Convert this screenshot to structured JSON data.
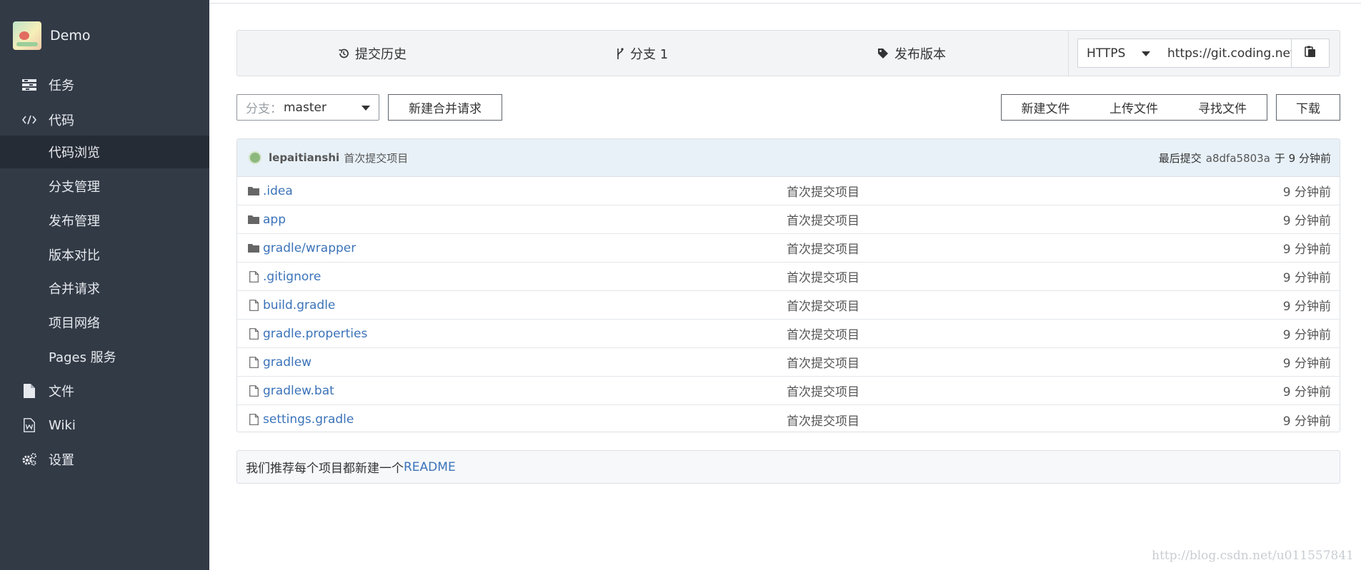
{
  "app": {
    "project_name": "Demo"
  },
  "sidebar": {
    "items": [
      {
        "label": "任务",
        "icon": "tasks-icon"
      },
      {
        "label": "代码",
        "icon": "code-icon"
      },
      {
        "label": "代码浏览",
        "sub": true,
        "active": true
      },
      {
        "label": "分支管理",
        "sub": true
      },
      {
        "label": "发布管理",
        "sub": true
      },
      {
        "label": "版本对比",
        "sub": true
      },
      {
        "label": "合并请求",
        "sub": true
      },
      {
        "label": "项目网络",
        "sub": true
      },
      {
        "label": "Pages 服务",
        "sub": true
      },
      {
        "label": "文件",
        "icon": "file-icon"
      },
      {
        "label": "Wiki",
        "icon": "wiki-icon"
      },
      {
        "label": "设置",
        "icon": "gears-icon"
      }
    ]
  },
  "repo_bar": {
    "history_label": "提交历史",
    "branches_label": "分支 1",
    "releases_label": "发布版本",
    "protocol": "HTTPS",
    "clone_url": "https://git.coding.net/le"
  },
  "toolbar": {
    "branch_prefix": "分支：",
    "branch_value": "master",
    "new_merge_request": "新建合并请求",
    "new_file": "新建文件",
    "upload_file": "上传文件",
    "find_file": "寻找文件",
    "download": "下载"
  },
  "last_commit": {
    "author": "lepaitianshi",
    "message": "首次提交项目",
    "prefix": "最后提交",
    "hash": "a8dfa5803a",
    "time": "于 9 分钟前"
  },
  "files": [
    {
      "name": ".idea",
      "type": "folder",
      "commit": "首次提交项目",
      "time": "9 分钟前"
    },
    {
      "name": "app",
      "type": "folder",
      "commit": "首次提交项目",
      "time": "9 分钟前"
    },
    {
      "name": "gradle/wrapper",
      "type": "folder",
      "commit": "首次提交项目",
      "time": "9 分钟前"
    },
    {
      "name": ".gitignore",
      "type": "file",
      "commit": "首次提交项目",
      "time": "9 分钟前"
    },
    {
      "name": "build.gradle",
      "type": "file",
      "commit": "首次提交项目",
      "time": "9 分钟前"
    },
    {
      "name": "gradle.properties",
      "type": "file",
      "commit": "首次提交项目",
      "time": "9 分钟前"
    },
    {
      "name": "gradlew",
      "type": "file",
      "commit": "首次提交项目",
      "time": "9 分钟前"
    },
    {
      "name": "gradlew.bat",
      "type": "file",
      "commit": "首次提交项目",
      "time": "9 分钟前"
    },
    {
      "name": "settings.gradle",
      "type": "file",
      "commit": "首次提交项目",
      "time": "9 分钟前"
    }
  ],
  "readme_notice": {
    "text": "我们推荐每个项目都新建一个",
    "link": "README"
  },
  "watermark": "http://blog.csdn.net/u011557841"
}
